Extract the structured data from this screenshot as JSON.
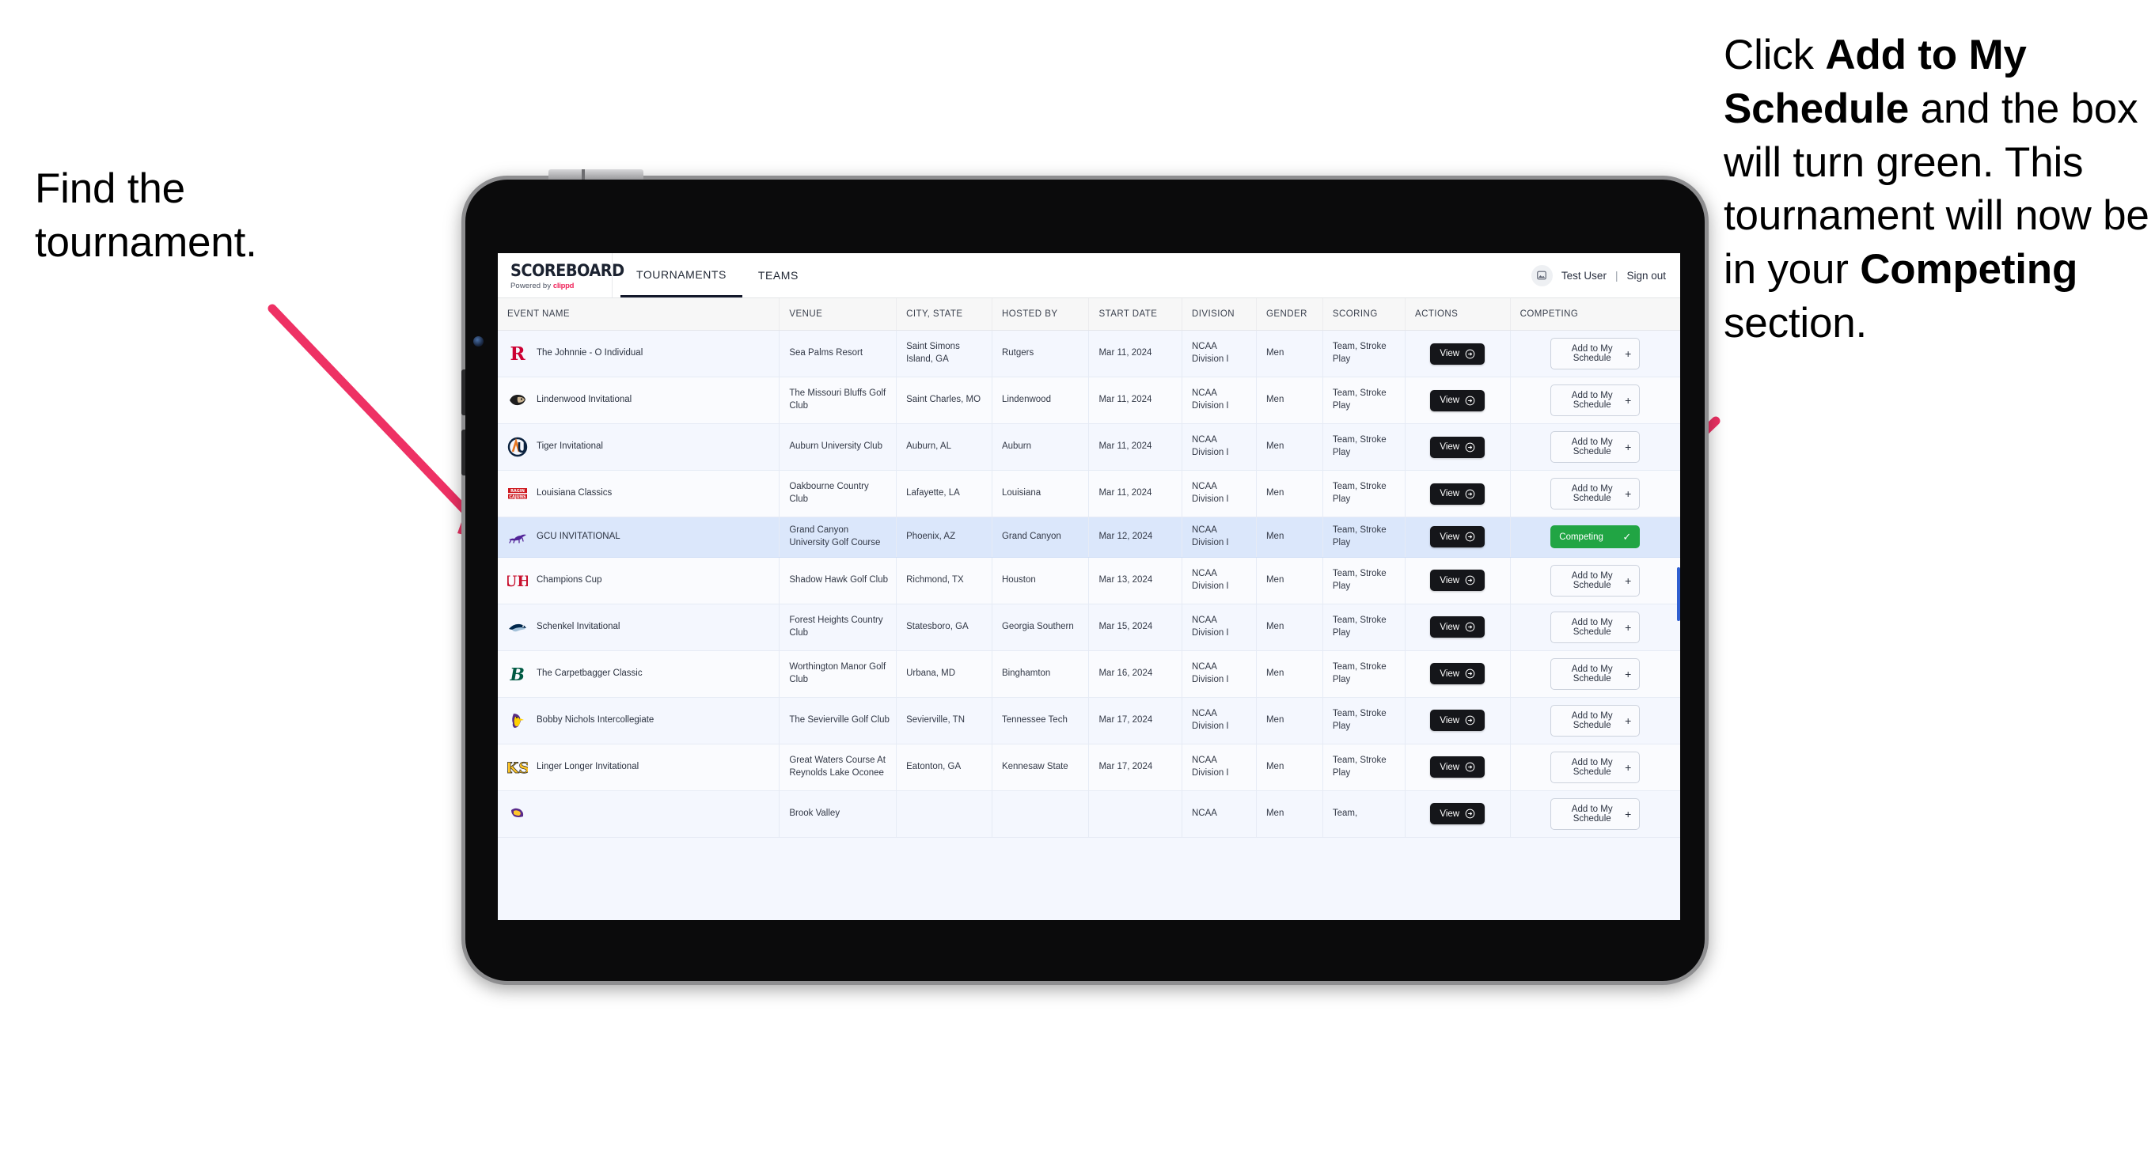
{
  "annotations": {
    "left": {
      "line1": "Find the",
      "line2": "tournament."
    },
    "right": {
      "seg1": "Click ",
      "bold1": "Add to My Schedule",
      "seg2": " and the box will turn green. This tournament will now be in your ",
      "bold2": "Competing",
      "seg3": " section."
    },
    "arrow_color": "#ee3164"
  },
  "brand": {
    "title": "SCOREBOARD",
    "powered_prefix": "Powered by ",
    "powered_name": "clippd",
    "accent": "#f0265c"
  },
  "nav": {
    "tabs": [
      {
        "label": "TOURNAMENTS",
        "active": true
      },
      {
        "label": "TEAMS",
        "active": false
      }
    ],
    "user": "Test User",
    "divider": "|",
    "signout": "Sign out"
  },
  "table": {
    "columns": [
      "EVENT NAME",
      "VENUE",
      "CITY, STATE",
      "HOSTED BY",
      "START DATE",
      "DIVISION",
      "GENDER",
      "SCORING",
      "ACTIONS",
      "COMPETING"
    ],
    "view_label": "View",
    "add_label": "Add to My Schedule",
    "add_plus": "+",
    "competing_label": "Competing",
    "competing_check": "✓",
    "competing_color": "#21a544",
    "rows": [
      {
        "event": "The Johnnie - O Individual",
        "venue": "Sea Palms Resort",
        "city": "Saint Simons Island, GA",
        "host": "Rutgers",
        "date": "Mar 11, 2024",
        "division": "NCAA Division I",
        "gender": "Men",
        "scoring": "Team, Stroke Play",
        "competing": false,
        "logo": "rutgers-r-logo"
      },
      {
        "event": "Lindenwood Invitational",
        "venue": "The Missouri Bluffs Golf Club",
        "city": "Saint Charles, MO",
        "host": "Lindenwood",
        "date": "Mar 11, 2024",
        "division": "NCAA Division I",
        "gender": "Men",
        "scoring": "Team, Stroke Play",
        "competing": false,
        "logo": "lindenwood-lion-logo"
      },
      {
        "event": "Tiger Invitational",
        "venue": "Auburn University Club",
        "city": "Auburn, AL",
        "host": "Auburn",
        "date": "Mar 11, 2024",
        "division": "NCAA Division I",
        "gender": "Men",
        "scoring": "Team, Stroke Play",
        "competing": false,
        "logo": "auburn-au-logo"
      },
      {
        "event": "Louisiana Classics",
        "venue": "Oakbourne Country Club",
        "city": "Lafayette, LA",
        "host": "Louisiana",
        "date": "Mar 11, 2024",
        "division": "NCAA Division I",
        "gender": "Men",
        "scoring": "Team, Stroke Play",
        "competing": false,
        "logo": "ragin-cajuns-logo"
      },
      {
        "event": "GCU INVITATIONAL",
        "venue": "Grand Canyon University Golf Course",
        "city": "Phoenix, AZ",
        "host": "Grand Canyon",
        "date": "Mar 12, 2024",
        "division": "NCAA Division I",
        "gender": "Men",
        "scoring": "Team, Stroke Play",
        "competing": true,
        "logo": "grand-canyon-lope-logo"
      },
      {
        "event": "Champions Cup",
        "venue": "Shadow Hawk Golf Club",
        "city": "Richmond, TX",
        "host": "Houston",
        "date": "Mar 13, 2024",
        "division": "NCAA Division I",
        "gender": "Men",
        "scoring": "Team, Stroke Play",
        "competing": false,
        "logo": "houston-uh-logo"
      },
      {
        "event": "Schenkel Invitational",
        "venue": "Forest Heights Country Club",
        "city": "Statesboro, GA",
        "host": "Georgia Southern",
        "date": "Mar 15, 2024",
        "division": "NCAA Division I",
        "gender": "Men",
        "scoring": "Team, Stroke Play",
        "competing": false,
        "logo": "georgia-southern-eagle-logo"
      },
      {
        "event": "The Carpetbagger Classic",
        "venue": "Worthington Manor Golf Club",
        "city": "Urbana, MD",
        "host": "Binghamton",
        "date": "Mar 16, 2024",
        "division": "NCAA Division I",
        "gender": "Men",
        "scoring": "Team, Stroke Play",
        "competing": false,
        "logo": "binghamton-b-logo"
      },
      {
        "event": "Bobby Nichols Intercollegiate",
        "venue": "The Sevierville Golf Club",
        "city": "Sevierville, TN",
        "host": "Tennessee Tech",
        "date": "Mar 17, 2024",
        "division": "NCAA Division I",
        "gender": "Men",
        "scoring": "Team, Stroke Play",
        "competing": false,
        "logo": "tennessee-tech-eagle-logo"
      },
      {
        "event": "Linger Longer Invitational",
        "venue": "Great Waters Course At Reynolds Lake Oconee",
        "city": "Eatonton, GA",
        "host": "Kennesaw State",
        "date": "Mar 17, 2024",
        "division": "NCAA Division I",
        "gender": "Men",
        "scoring": "Team, Stroke Play",
        "competing": false,
        "logo": "kennesaw-state-ksu-logo"
      },
      {
        "event": "",
        "venue": "Brook Valley",
        "city": "",
        "host": "",
        "date": "",
        "division": "NCAA",
        "gender": "Men",
        "scoring": "Team,",
        "competing": false,
        "logo": "east-carolina-logo",
        "partial": true
      }
    ]
  }
}
